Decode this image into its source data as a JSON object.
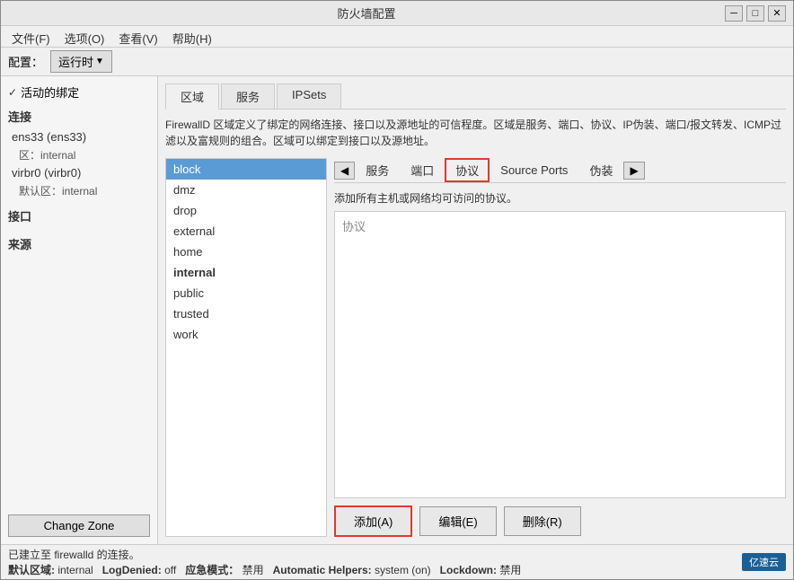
{
  "window": {
    "title": "防火墙配置",
    "min_label": "─",
    "max_label": "□",
    "close_label": "✕"
  },
  "menu": {
    "items": [
      {
        "label": "文件(F)"
      },
      {
        "label": "选项(O)"
      },
      {
        "label": "查看(V)"
      },
      {
        "label": "帮助(H)"
      }
    ]
  },
  "toolbar": {
    "config_label": "配置：",
    "runtime_label": "运行时",
    "arrow": "▼"
  },
  "sidebar": {
    "active_section": "活动的绑定",
    "connection_title": "连接",
    "items": [
      {
        "label": "ens33 (ens33)",
        "sub": "区：internal"
      },
      {
        "label": "virbr0 (virbr0)",
        "sub": "默认区：internal"
      }
    ],
    "port_title": "接口",
    "source_title": "来源",
    "change_zone_btn": "Change Zone"
  },
  "tabs": {
    "items": [
      {
        "label": "区域"
      },
      {
        "label": "服务"
      },
      {
        "label": "IPSets"
      }
    ]
  },
  "description": "FirewallD 区域定义了绑定的网络连接、接口以及源地址的可信程度。区域是服务、端口、协议、IP伪装、端口/报文转发、ICMP过滤以及富规则的组合。区域可以绑定到接口以及源地址。",
  "zones": {
    "list": [
      {
        "label": "block",
        "selected": true,
        "bold": false
      },
      {
        "label": "dmz",
        "selected": false,
        "bold": false
      },
      {
        "label": "drop",
        "selected": false,
        "bold": false
      },
      {
        "label": "external",
        "selected": false,
        "bold": false
      },
      {
        "label": "home",
        "selected": false,
        "bold": false
      },
      {
        "label": "internal",
        "selected": false,
        "bold": true
      },
      {
        "label": "public",
        "selected": false,
        "bold": false
      },
      {
        "label": "trusted",
        "selected": false,
        "bold": false
      },
      {
        "label": "work",
        "selected": false,
        "bold": false
      }
    ]
  },
  "detail_tabs": {
    "prev": "◀",
    "next": "▶",
    "items": [
      {
        "label": "服务"
      },
      {
        "label": "端口"
      },
      {
        "label": "协议",
        "active": true
      },
      {
        "label": "Source Ports"
      },
      {
        "label": "伪装"
      }
    ]
  },
  "protocol_section": {
    "desc": "添加所有主机或网络均可访问的协议。",
    "header": "协议"
  },
  "buttons": {
    "add": "添加(A)",
    "edit": "编辑(E)",
    "delete": "删除(R)"
  },
  "status": {
    "connection": "已建立至 firewalld 的连接。",
    "default_zone_label": "默认区域:",
    "default_zone": "internal",
    "log_denied_label": "LogDenied:",
    "log_denied": "off",
    "emergency_label": "应急模式：",
    "emergency": "禁用",
    "helpers_label": "Automatic Helpers:",
    "helpers": "system (on)",
    "lockdown_label": "Lockdown:",
    "lockdown": "禁用",
    "logo": "亿速云"
  }
}
